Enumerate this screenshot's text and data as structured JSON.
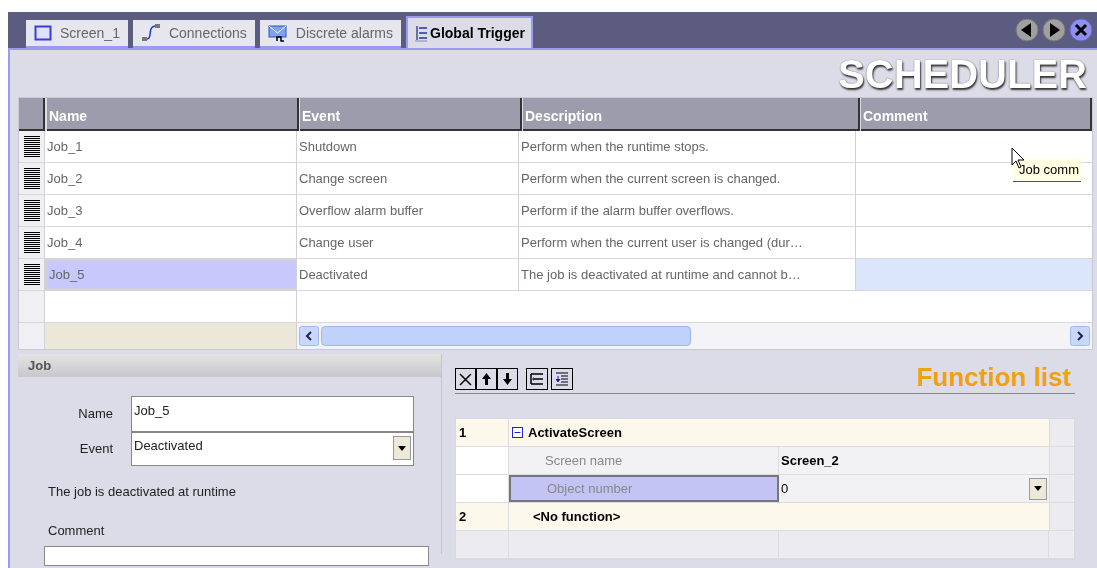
{
  "tabs": [
    {
      "label": "Screen_1",
      "kind": "screen",
      "selected": false
    },
    {
      "label": "Connections",
      "kind": "connections",
      "selected": false
    },
    {
      "label": "Discrete alarms",
      "kind": "alarms",
      "selected": false
    },
    {
      "label": "Global Trigger",
      "kind": "trigger",
      "selected": true
    }
  ],
  "title": "SCHEDULER",
  "table": {
    "columns": [
      "Name",
      "Event",
      "Description",
      "Comment"
    ],
    "rows": [
      {
        "name": "Job_1",
        "event": "Shutdown",
        "description": "Perform when the runtime stops.",
        "selected": false
      },
      {
        "name": "Job_2",
        "event": "Change screen",
        "description": "Perform when the current screen is changed.",
        "selected": false
      },
      {
        "name": "Job_3",
        "event": "Overflow alarm buffer",
        "description": "Perform if the alarm buffer overflows.",
        "selected": false
      },
      {
        "name": "Job_4",
        "event": "Change user",
        "description": "Perform when the current user is changed (dur…",
        "selected": false
      },
      {
        "name": "Job_5",
        "event": "Deactivated",
        "description": "The job is deactivated at runtime and cannot b…",
        "selected": true
      }
    ]
  },
  "tooltip": "Job comm",
  "job_panel": {
    "title": "Job",
    "name_label": "Name",
    "name_value": "Job_5",
    "event_label": "Event",
    "event_value": "Deactivated",
    "description": "The job is deactivated at runtime",
    "comment_label": "Comment"
  },
  "function_list": {
    "title": "Function list",
    "rows": [
      {
        "kind": "function",
        "number": "1",
        "name": "ActivateScreen"
      },
      {
        "kind": "parameter",
        "label": "Screen name",
        "value": "Screen_2",
        "selected": false
      },
      {
        "kind": "parameter",
        "label": "Object number",
        "value": "0",
        "selected": true
      },
      {
        "kind": "placeholder",
        "number": "2",
        "name": "<No function>"
      }
    ]
  }
}
